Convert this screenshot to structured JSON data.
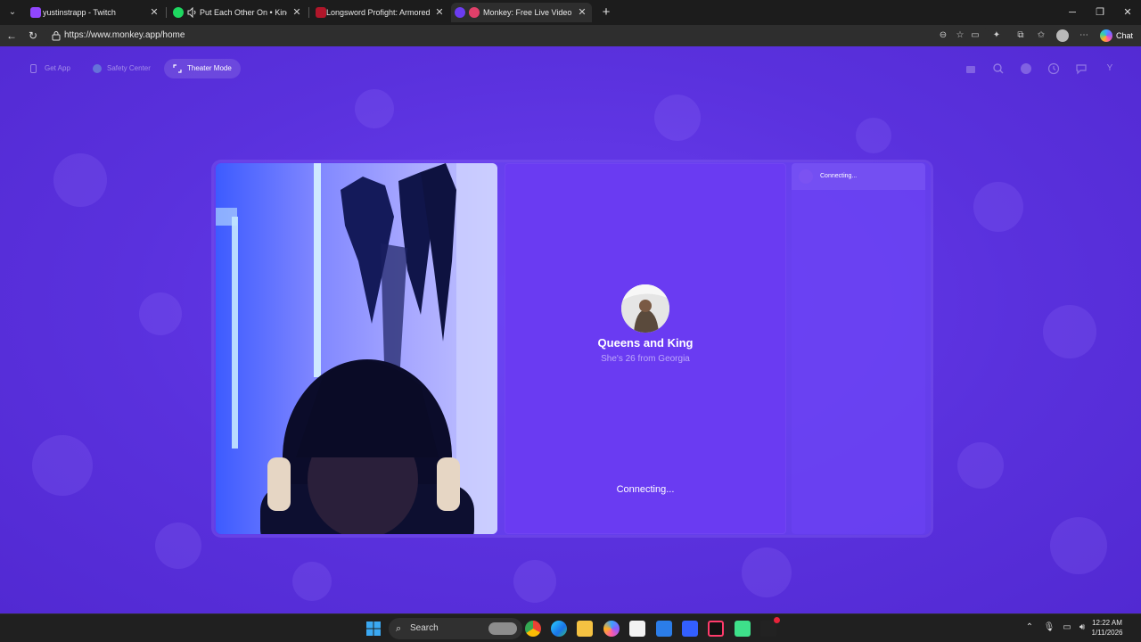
{
  "browser": {
    "tabs": [
      {
        "title": "yustinstrapp - Twitch",
        "active": false
      },
      {
        "title": "Put Each Other On • King Hen",
        "active": false,
        "audio": true
      },
      {
        "title": "Longsword Profight: Armored MM",
        "active": false
      },
      {
        "title": "Monkey: Free Live Video Chat",
        "active": true
      }
    ],
    "new_tab_symbol": "+",
    "url": "https://www.monkey.app/home",
    "chat_label": "Chat"
  },
  "page": {
    "nav": {
      "get_app": "Get App",
      "safety_center": "Safety Center",
      "theater_mode": "Theater Mode"
    },
    "profile_initial": "Y",
    "peer": {
      "name": "Queens and King",
      "subtitle": "She's 26 from Georgia"
    },
    "status": "Connecting...",
    "chat_status": "Connecting..."
  },
  "taskbar": {
    "search_label": "Search",
    "time": "12:22 AM",
    "date": "1/11/2026"
  },
  "colors": {
    "page_bg": "#5a31dd",
    "card_bg": "#6a3bf2",
    "browser_bg": "#1c1c1c"
  }
}
